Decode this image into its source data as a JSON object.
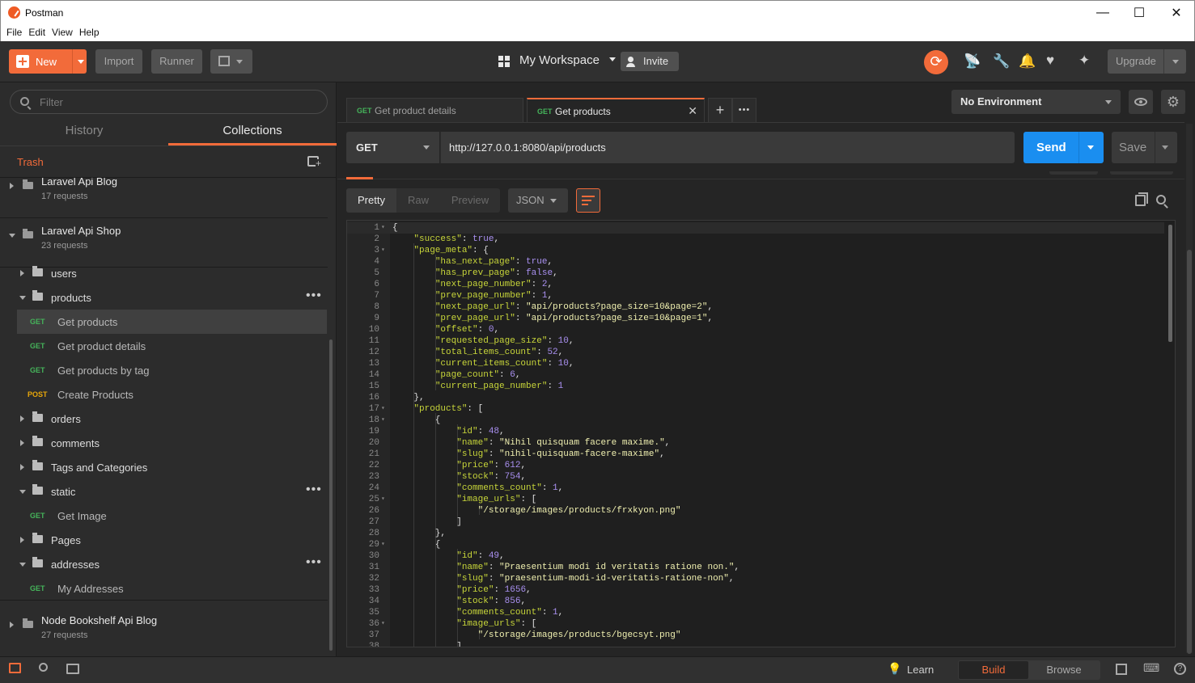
{
  "window": {
    "title": "Postman",
    "minimize": "—",
    "maximize": "☐",
    "close": "✕"
  },
  "menu": [
    "File",
    "Edit",
    "View",
    "Help"
  ],
  "header": {
    "new_label": "New",
    "import_label": "Import",
    "runner_label": "Runner",
    "workspace": "My Workspace",
    "invite": "Invite",
    "upgrade": "Upgrade"
  },
  "sidebar": {
    "filter_placeholder": "Filter",
    "tabs": [
      {
        "label": "History",
        "active": false
      },
      {
        "label": "Collections",
        "active": true
      }
    ],
    "trash": "Trash",
    "collections": [
      {
        "name": "Laravel Api Blog",
        "requests": "17 requests"
      },
      {
        "name": "Laravel Api Shop",
        "requests": "23 requests"
      },
      {
        "name": "Node Bookshelf Api Blog",
        "requests": "27 requests"
      }
    ],
    "items": [
      {
        "type": "folder",
        "name": "users",
        "open": false
      },
      {
        "type": "folder",
        "name": "products",
        "open": true,
        "dots": "•••"
      },
      {
        "type": "request",
        "method": "GET",
        "name": "Get products",
        "selected": true
      },
      {
        "type": "request",
        "method": "GET",
        "name": "Get product details"
      },
      {
        "type": "request",
        "method": "GET",
        "name": "Get products by tag"
      },
      {
        "type": "request",
        "method": "POST",
        "name": "Create Products"
      },
      {
        "type": "folder",
        "name": "orders",
        "open": false
      },
      {
        "type": "folder",
        "name": "comments",
        "open": false
      },
      {
        "type": "folder",
        "name": "Tags and Categories",
        "open": false
      },
      {
        "type": "folder",
        "name": "static",
        "open": true,
        "dots": "•••"
      },
      {
        "type": "request",
        "method": "GET",
        "name": "Get Image"
      },
      {
        "type": "folder",
        "name": "Pages",
        "open": false
      },
      {
        "type": "folder",
        "name": "addresses",
        "open": true,
        "dots": "•••"
      },
      {
        "type": "request",
        "method": "GET",
        "name": "My Addresses"
      }
    ]
  },
  "tabs": [
    {
      "method": "GET",
      "name": "Get product details",
      "active": false
    },
    {
      "method": "GET",
      "name": "Get products",
      "active": true,
      "close": "✕"
    }
  ],
  "tab_add": "+",
  "tab_more": "•••",
  "environment": "No Environment",
  "request": {
    "method": "GET",
    "url": "http://127.0.0.1:8080/api/products",
    "send": "Send",
    "save": "Save"
  },
  "response": {
    "views": [
      "Pretty",
      "Raw",
      "Preview"
    ],
    "active_view": "Pretty",
    "format": "JSON"
  },
  "code_lines": [
    "{",
    "    \"success\": true,",
    "    \"page_meta\": {",
    "        \"has_next_page\": true,",
    "        \"has_prev_page\": false,",
    "        \"next_page_number\": 2,",
    "        \"prev_page_number\": 1,",
    "        \"next_page_url\": \"api/products?page_size=10&page=2\",",
    "        \"prev_page_url\": \"api/products?page_size=10&page=1\",",
    "        \"offset\": 0,",
    "        \"requested_page_size\": 10,",
    "        \"total_items_count\": 52,",
    "        \"current_items_count\": 10,",
    "        \"page_count\": 6,",
    "        \"current_page_number\": 1",
    "    },",
    "    \"products\": [",
    "        {",
    "            \"id\": 48,",
    "            \"name\": \"Nihil quisquam facere maxime.\",",
    "            \"slug\": \"nihil-quisquam-facere-maxime\",",
    "            \"price\": 612,",
    "            \"stock\": 754,",
    "            \"comments_count\": 1,",
    "            \"image_urls\": [",
    "                \"/storage/images/products/frxkyon.png\"",
    "            ]",
    "        },",
    "        {",
    "            \"id\": 49,",
    "            \"name\": \"Praesentium modi id veritatis ratione non.\",",
    "            \"slug\": \"praesentium-modi-id-veritatis-ratione-non\",",
    "            \"price\": 1656,",
    "            \"stock\": 856,",
    "            \"comments_count\": 1,",
    "            \"image_urls\": [",
    "                \"/storage/images/products/bgecsyt.png\"",
    "            ]"
  ],
  "fold_lines": [
    1,
    3,
    17,
    18,
    25,
    29,
    36
  ],
  "footer": {
    "learn": "Learn",
    "build": "Build",
    "browse": "Browse"
  }
}
